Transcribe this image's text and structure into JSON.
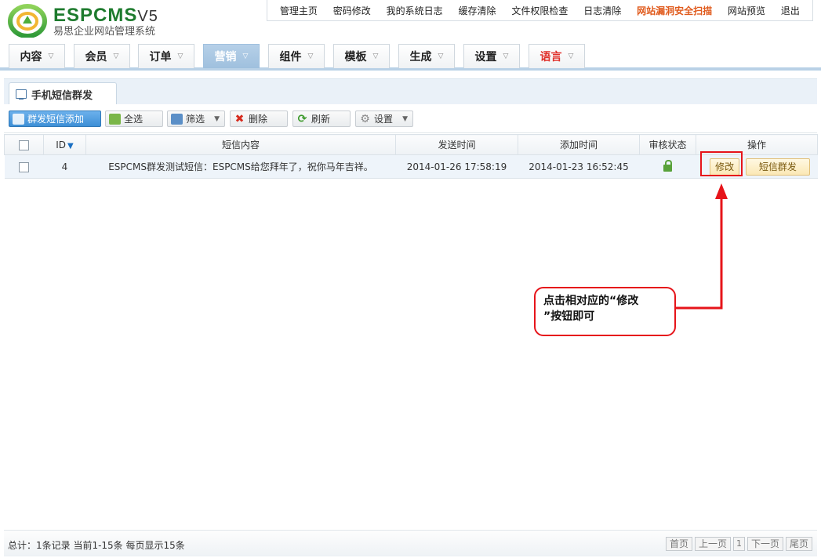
{
  "header": {
    "brand_main": "ESPCMS",
    "brand_version": "V5",
    "brand_sub": "易思企业网站管理系统",
    "top_links": [
      "管理主页",
      "密码修改",
      "我的系统日志",
      "缓存清除",
      "文件权限检查",
      "日志清除",
      "网站漏洞安全扫描",
      "网站预览",
      "退出"
    ],
    "top_links_hot": "网站漏洞安全扫描"
  },
  "nav": {
    "tabs": [
      "内容",
      "会员",
      "订单",
      "营销",
      "组件",
      "模板",
      "生成",
      "设置",
      "语言"
    ],
    "active": "营销",
    "red": "语言"
  },
  "page_tab": {
    "label": "手机短信群发"
  },
  "toolbar": {
    "add": "群发短信添加",
    "select_all": "全选",
    "filter": "筛选",
    "delete": "删除",
    "refresh": "刷新",
    "settings": "设置"
  },
  "table": {
    "columns": [
      "ID",
      "短信内容",
      "发送时间",
      "添加时间",
      "审核状态",
      "操作"
    ],
    "rows": [
      {
        "id": "4",
        "content": "ESPCMS群发测试短信：ESPCMS给您拜年了，祝你马年吉祥。",
        "send_time": "2014-01-26 17:58:19",
        "add_time": "2014-01-23 16:52:45",
        "edit_label": "修改",
        "send_label": "短信群发"
      }
    ]
  },
  "annotation": {
    "line1": "点击相对应的“修改",
    "line2": "”按钮即可"
  },
  "footer": {
    "stats": "总计：1条记录 当前1-15条 每页显示15条",
    "first": "首页",
    "prev": "上一页",
    "page": "1",
    "next": "下一页",
    "last": "尾页"
  },
  "colors": {
    "accent": "#3d8fd6",
    "annotation": "#e6141a",
    "hot_link": "#e05a1c",
    "brand": "#1e7b2e"
  }
}
